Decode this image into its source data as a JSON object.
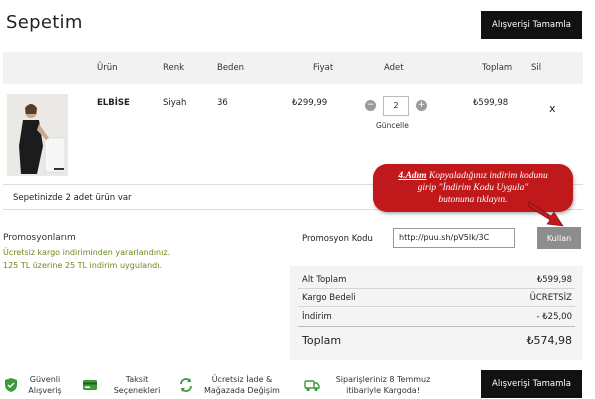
{
  "header": {
    "title": "Sepetim",
    "checkout_label": "Alışverişi Tamamla"
  },
  "table": {
    "columns": [
      "Ürün",
      "Renk",
      "Beden",
      "Fiyat",
      "Adet",
      "Toplam",
      "Sil"
    ]
  },
  "item": {
    "name": "ELBİSE",
    "color": "Siyah",
    "size": "36",
    "price": "₺299,99",
    "quantity": "2",
    "update_label": "Güncelle",
    "total": "₺599,98",
    "remove_label": "x"
  },
  "cart_summary": "Sepetinizde 2 adet ürün var",
  "promotions": {
    "title": "Promosyonlarım",
    "messages": [
      "Ücretsiz kargo indiriminden yararlandınız.",
      "125 TL üzerine 25 TL indirim uygulandı."
    ],
    "code_label": "Promosyon Kodu",
    "code_value": "http://puu.sh/pV5Ik/3C",
    "apply_label": "Kullan"
  },
  "callout": {
    "step": "4.Adım",
    "line1": " Kopyaladığınız indirim kodunu",
    "line2": "girip \"İndirim Kodu Uygula\"",
    "line3": "butonuna tıklayın."
  },
  "totals": {
    "subtotal_label": "Alt Toplam",
    "subtotal_value": "₺599,98",
    "shipping_label": "Kargo Bedeli",
    "shipping_value": "ÜCRETSİZ",
    "discount_label": "İndirim",
    "discount_value": "- ₺25,00",
    "grand_label": "Toplam",
    "grand_value": "₺574,98"
  },
  "features": {
    "secure_line1": "Güvenli",
    "secure_line2": "Alışveriş",
    "installment_line1": "Taksit",
    "installment_line2": "Seçenekleri",
    "return_line1": "Ücretsiz İade &",
    "return_line2": "Mağazada Değişim",
    "shipping_line1": "Siparişleriniz 8 Temmuz",
    "shipping_line2": "itibariyle Kargoda!"
  },
  "colors": {
    "accent_green": "#6a8a1a",
    "callout_red": "#c0191b",
    "button_black": "#111111"
  }
}
